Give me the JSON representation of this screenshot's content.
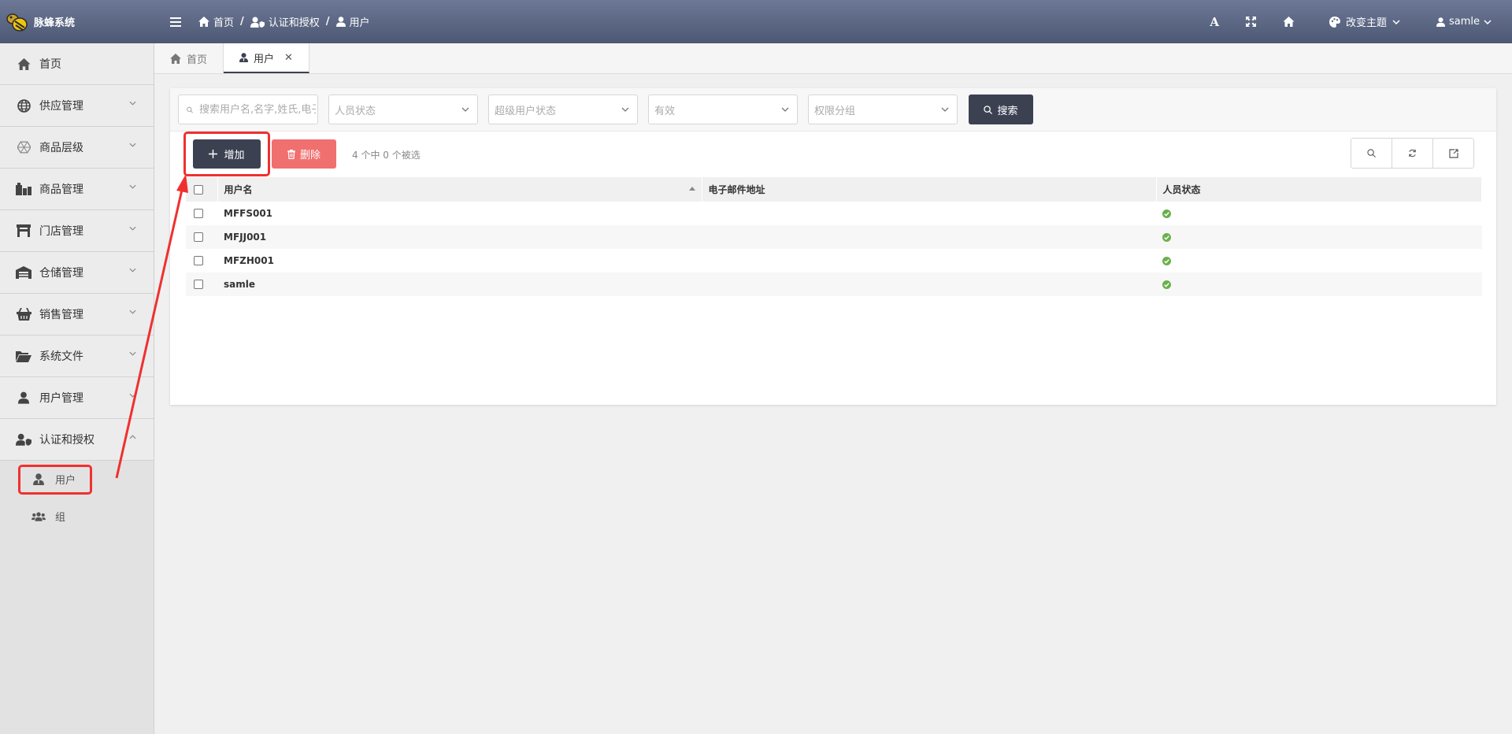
{
  "app": {
    "name": "脉蜂系统"
  },
  "breadcrumb": {
    "items": [
      "首页",
      "认证和授权",
      "用户"
    ]
  },
  "toolbar": {
    "theme_label": "改变主题",
    "user_name": "samle"
  },
  "sidebar": {
    "items": [
      {
        "label": "首页"
      },
      {
        "label": "供应管理"
      },
      {
        "label": "商品层级"
      },
      {
        "label": "商品管理"
      },
      {
        "label": "门店管理"
      },
      {
        "label": "仓储管理"
      },
      {
        "label": "销售管理"
      },
      {
        "label": "系统文件"
      },
      {
        "label": "用户管理"
      },
      {
        "label": "认证和授权"
      }
    ],
    "subitems": [
      {
        "label": "用户"
      },
      {
        "label": "组"
      }
    ]
  },
  "tabs": [
    {
      "label": "首页"
    },
    {
      "label": "用户"
    }
  ],
  "filters": {
    "search_placeholder": "搜索用户名,名字,姓氏,电子邮件地址",
    "selects": [
      "人员状态",
      "超级用户状态",
      "有效",
      "权限分组"
    ],
    "search_button": "搜索"
  },
  "actions": {
    "add_label": "增加",
    "delete_label": "删除",
    "selection_info": "4 个中 0 个被选"
  },
  "table": {
    "columns": [
      "用户名",
      "电子邮件地址",
      "人员状态"
    ],
    "rows": [
      {
        "username": "MFFS001",
        "email": "",
        "staff": true
      },
      {
        "username": "MFJJ001",
        "email": "",
        "staff": true
      },
      {
        "username": "MFZH001",
        "email": "",
        "staff": true
      },
      {
        "username": "samle",
        "email": "",
        "staff": true
      }
    ]
  },
  "colors": {
    "topbar": "#5c6785",
    "primary_button": "#3c4152",
    "danger_button": "#f07070",
    "highlight": "#f03030",
    "status_ok": "#6ab04c"
  }
}
